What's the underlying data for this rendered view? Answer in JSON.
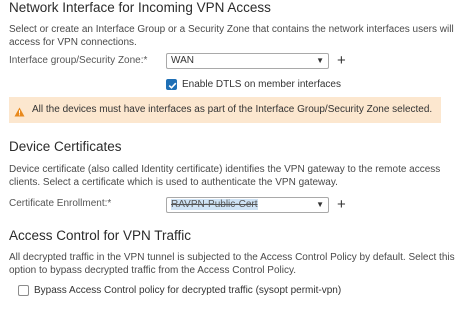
{
  "network_section": {
    "title": "Network Interface for Incoming VPN Access",
    "description": "Select or create an Interface Group or a Security Zone that contains the network interfaces users will access for VPN connections.",
    "interface_label": "Interface group/Security Zone:*",
    "interface_value": "WAN",
    "dtls_label": "Enable DTLS on member interfaces",
    "dtls_checked": true,
    "warning_text": "All the devices must have interfaces as part of the Interface Group/Security Zone selected."
  },
  "certificates_section": {
    "title": "Device Certificates",
    "description": "Device certificate (also called Identity certificate) identifies the VPN gateway to the remote access clients. Select a certificate which is used to authenticate the VPN gateway.",
    "enrollment_label": "Certificate Enrollment:*",
    "enrollment_value": "RAVPN-Public-Cert"
  },
  "access_control_section": {
    "title": "Access Control for VPN Traffic",
    "description": "All decrypted traffic in the VPN tunnel is subjected to the Access Control Policy by default. Select this option to bypass decrypted traffic from the Access Control Policy.",
    "bypass_label": "Bypass Access Control policy for decrypted traffic (sysopt permit-vpn)",
    "bypass_checked": false
  },
  "icons": {
    "plus": "plus-icon",
    "dropdown": "chevron-down-icon",
    "warning": "warning-icon",
    "check": "check-icon"
  },
  "colors": {
    "accent": "#1f6fb5",
    "warning_bg": "#fce7cf",
    "warning_icon": "#e8891d"
  }
}
